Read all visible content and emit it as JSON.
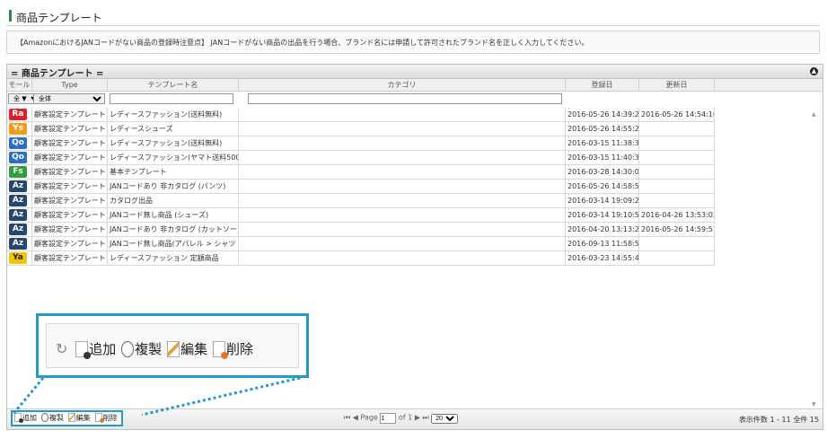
{
  "page": {
    "title": "商品テンプレート"
  },
  "notice": "【AmazonにおけるJANコードがない商品の登録時注意点】 JANコードがない商品の出品を行う場合、ブランド名には申請して許可されたブランド名を正しく入力してください。",
  "grid": {
    "caption": "= 商品テンプレート =",
    "collapse_icon": "up-arrow-icon",
    "columns": [
      "モール",
      "Type",
      "テンプレート名",
      "カテゴリ",
      "登録日",
      "更新日"
    ],
    "filters": {
      "mall_select": "全 ▼",
      "type_select": "全体",
      "name_value": "",
      "category_value": ""
    },
    "rows": [
      {
        "mall": "Ra",
        "color": "#d9232a",
        "type": "顧客設定テンプレート",
        "name": "レディースファッション(送料無料)",
        "category": "",
        "created": "2016-05-26 14:39:28",
        "updated": "2016-05-26 14:54:10"
      },
      {
        "mall": "Ys",
        "color": "#f29a1a",
        "type": "顧客設定テンプレート",
        "name": "レディースシューズ",
        "category": "",
        "created": "2016-05-26 14:55:28",
        "updated": ""
      },
      {
        "mall": "Qo",
        "color": "#2a6fc4",
        "type": "顧客設定テンプレート",
        "name": "レディースファッション(送料無料)",
        "category": "",
        "created": "2016-03-15 11:38:30",
        "updated": ""
      },
      {
        "mall": "Qo",
        "color": "#2a6fc4",
        "type": "顧客設定テンプレート",
        "name": "レディースファッション(ヤマト送料500円",
        "category": "",
        "created": "2016-03-15 11:40:35",
        "updated": ""
      },
      {
        "mall": "Fs",
        "color": "#2e9f3a",
        "type": "顧客設定テンプレート",
        "name": "基本テンプレート",
        "category": "",
        "created": "2016-03-28 14:30:05",
        "updated": ""
      },
      {
        "mall": "Az",
        "color": "#24476b",
        "type": "顧客設定テンプレート",
        "name": "JANコードあり 非カタログ (パンツ)",
        "category": "",
        "created": "2016-05-26 14:58:54",
        "updated": ""
      },
      {
        "mall": "Az",
        "color": "#24476b",
        "type": "顧客設定テンプレート",
        "name": "カタログ出品",
        "category": "",
        "created": "2016-03-14 19:09:22",
        "updated": ""
      },
      {
        "mall": "Az",
        "color": "#24476b",
        "type": "顧客設定テンプレート",
        "name": "JANコード無し商品 (シューズ)",
        "category": "",
        "created": "2016-03-14 19:10:53",
        "updated": "2016-04-26 13:53:02"
      },
      {
        "mall": "Az",
        "color": "#24476b",
        "type": "顧客設定テンプレート",
        "name": "JANコードあり 非カタログ (カットソー)",
        "category": "",
        "created": "2016-04-20 13:13:26",
        "updated": "2016-05-26 14:59:57"
      },
      {
        "mall": "Az",
        "color": "#24476b",
        "type": "顧客設定テンプレート",
        "name": "JANコード無し商品(アパレル > シャツ・ブ",
        "category": "",
        "created": "2016-09-13 11:58:50",
        "updated": ""
      },
      {
        "mall": "Ya",
        "color": "#f5c400",
        "type": "顧客設定テンプレート",
        "name": "レディースファッション 定額商品",
        "category": "",
        "created": "2016-03-23 14:55:45",
        "updated": ""
      }
    ]
  },
  "toolbar": {
    "add": "追加",
    "copy": "複製",
    "edit": "編集",
    "delete": "削除"
  },
  "pager": {
    "page_label": "Page",
    "page_value": "1",
    "of_label": "of 1",
    "page_size": "20",
    "summary": "表示件数 1 - 11 全件 15"
  }
}
